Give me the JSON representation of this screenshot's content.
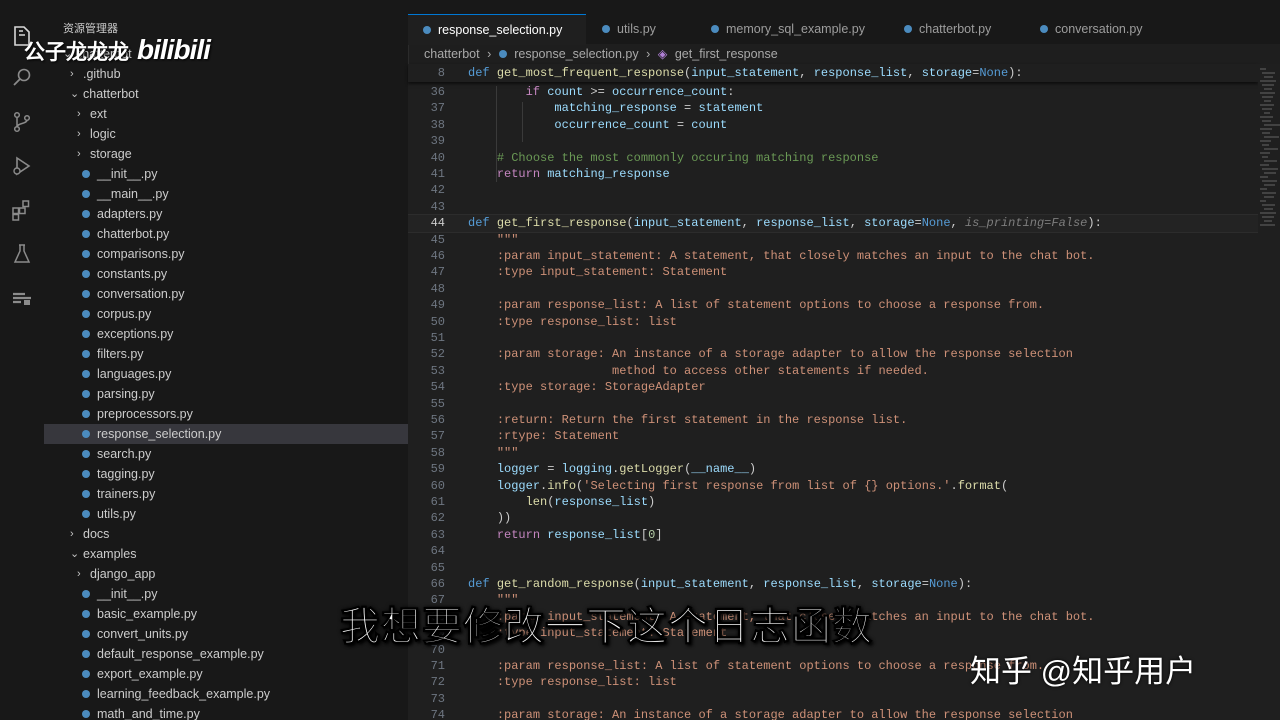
{
  "explorer": {
    "title": "资源管理器",
    "items": [
      {
        "label": "chatterbot",
        "kind": "folder",
        "open": true,
        "indent": 0
      },
      {
        "label": ".github",
        "kind": "folder",
        "open": false,
        "indent": 1
      },
      {
        "label": "chatterbot",
        "kind": "folder",
        "open": true,
        "indent": 1
      },
      {
        "label": "ext",
        "kind": "folder",
        "open": false,
        "indent": 2
      },
      {
        "label": "logic",
        "kind": "folder",
        "open": false,
        "indent": 2
      },
      {
        "label": "storage",
        "kind": "folder",
        "open": false,
        "indent": 2
      },
      {
        "label": "__init__.py",
        "kind": "py",
        "indent": 2
      },
      {
        "label": "__main__.py",
        "kind": "py",
        "indent": 2
      },
      {
        "label": "adapters.py",
        "kind": "py",
        "indent": 2
      },
      {
        "label": "chatterbot.py",
        "kind": "py",
        "indent": 2
      },
      {
        "label": "comparisons.py",
        "kind": "py",
        "indent": 2
      },
      {
        "label": "constants.py",
        "kind": "py",
        "indent": 2
      },
      {
        "label": "conversation.py",
        "kind": "py",
        "indent": 2
      },
      {
        "label": "corpus.py",
        "kind": "py",
        "indent": 2
      },
      {
        "label": "exceptions.py",
        "kind": "py",
        "indent": 2
      },
      {
        "label": "filters.py",
        "kind": "py",
        "indent": 2
      },
      {
        "label": "languages.py",
        "kind": "py",
        "indent": 2
      },
      {
        "label": "parsing.py",
        "kind": "py",
        "indent": 2
      },
      {
        "label": "preprocessors.py",
        "kind": "py",
        "indent": 2
      },
      {
        "label": "response_selection.py",
        "kind": "py",
        "indent": 2,
        "selected": true
      },
      {
        "label": "search.py",
        "kind": "py",
        "indent": 2
      },
      {
        "label": "tagging.py",
        "kind": "py",
        "indent": 2
      },
      {
        "label": "trainers.py",
        "kind": "py",
        "indent": 2
      },
      {
        "label": "utils.py",
        "kind": "py",
        "indent": 2
      },
      {
        "label": "docs",
        "kind": "folder",
        "open": false,
        "indent": 1
      },
      {
        "label": "examples",
        "kind": "folder",
        "open": true,
        "indent": 1
      },
      {
        "label": "django_app",
        "kind": "folder",
        "open": false,
        "indent": 2
      },
      {
        "label": "__init__.py",
        "kind": "py",
        "indent": 2
      },
      {
        "label": "basic_example.py",
        "kind": "py",
        "indent": 2
      },
      {
        "label": "convert_units.py",
        "kind": "py",
        "indent": 2
      },
      {
        "label": "default_response_example.py",
        "kind": "py",
        "indent": 2
      },
      {
        "label": "export_example.py",
        "kind": "py",
        "indent": 2
      },
      {
        "label": "learning_feedback_example.py",
        "kind": "py",
        "indent": 2
      },
      {
        "label": "math_and_time.py",
        "kind": "py",
        "indent": 2
      }
    ]
  },
  "tabs": [
    {
      "label": "response_selection.py",
      "active": true
    },
    {
      "label": "utils.py",
      "active": false
    },
    {
      "label": "memory_sql_example.py",
      "active": false
    },
    {
      "label": "chatterbot.py",
      "active": false
    },
    {
      "label": "conversation.py",
      "active": false
    }
  ],
  "breadcrumb": [
    "chatterbot",
    "›",
    "response_selection.py",
    "›",
    "get_first_response"
  ],
  "sticky": {
    "ln": "8",
    "tokens": [
      [
        "k",
        "def "
      ],
      [
        "fn",
        "get_most_frequent_response"
      ],
      [
        "",
        "("
      ],
      [
        "v",
        "input_statement"
      ],
      [
        "",
        ", "
      ],
      [
        "v",
        "response_list"
      ],
      [
        "",
        ", "
      ],
      [
        "v",
        "storage"
      ],
      [
        "",
        "="
      ],
      [
        "k",
        "None"
      ],
      [
        "",
        "):"
      ]
    ]
  },
  "code_lines": [
    {
      "ln": "36",
      "tokens": [
        [
          "",
          "        "
        ],
        [
          "kc",
          "if "
        ],
        [
          "v",
          "count"
        ],
        [
          "",
          " >= "
        ],
        [
          "v",
          "occurrence_count"
        ],
        [
          "",
          ":"
        ]
      ]
    },
    {
      "ln": "37",
      "tokens": [
        [
          "",
          "            "
        ],
        [
          "v",
          "matching_response"
        ],
        [
          "",
          " = "
        ],
        [
          "v",
          "statement"
        ]
      ]
    },
    {
      "ln": "38",
      "tokens": [
        [
          "",
          "            "
        ],
        [
          "v",
          "occurrence_count"
        ],
        [
          "",
          " = "
        ],
        [
          "v",
          "count"
        ]
      ]
    },
    {
      "ln": "39",
      "tokens": []
    },
    {
      "ln": "40",
      "tokens": [
        [
          "",
          "    "
        ],
        [
          "c",
          "# Choose the most commonly occuring matching response"
        ]
      ]
    },
    {
      "ln": "41",
      "tokens": [
        [
          "",
          "    "
        ],
        [
          "kc",
          "return "
        ],
        [
          "v",
          "matching_response"
        ]
      ]
    },
    {
      "ln": "42",
      "tokens": []
    },
    {
      "ln": "43",
      "tokens": []
    },
    {
      "ln": "44",
      "current": true,
      "tokens": [
        [
          "k",
          "def "
        ],
        [
          "fn",
          "get_first_response"
        ],
        [
          "",
          "("
        ],
        [
          "v",
          "input_statement"
        ],
        [
          "",
          ", "
        ],
        [
          "v",
          "response_list"
        ],
        [
          "",
          ", "
        ],
        [
          "v",
          "storage"
        ],
        [
          "",
          "="
        ],
        [
          "k",
          "None"
        ],
        [
          "",
          ", "
        ],
        [
          "hint",
          "is_printing=False"
        ],
        [
          "",
          "):"
        ]
      ]
    },
    {
      "ln": "45",
      "tokens": [
        [
          "",
          "    "
        ],
        [
          "s",
          "\"\"\""
        ]
      ]
    },
    {
      "ln": "46",
      "tokens": [
        [
          "",
          "    "
        ],
        [
          "s",
          ":param input_statement: A statement, that closely matches an input to the chat bot."
        ]
      ]
    },
    {
      "ln": "47",
      "tokens": [
        [
          "",
          "    "
        ],
        [
          "s",
          ":type input_statement: Statement"
        ]
      ]
    },
    {
      "ln": "48",
      "tokens": []
    },
    {
      "ln": "49",
      "tokens": [
        [
          "",
          "    "
        ],
        [
          "s",
          ":param response_list: A list of statement options to choose a response from."
        ]
      ]
    },
    {
      "ln": "50",
      "tokens": [
        [
          "",
          "    "
        ],
        [
          "s",
          ":type response_list: list"
        ]
      ]
    },
    {
      "ln": "51",
      "tokens": []
    },
    {
      "ln": "52",
      "tokens": [
        [
          "",
          "    "
        ],
        [
          "s",
          ":param storage: An instance of a storage adapter to allow the response selection"
        ]
      ]
    },
    {
      "ln": "53",
      "tokens": [
        [
          "",
          "                    "
        ],
        [
          "s",
          "method to access other statements if needed."
        ]
      ]
    },
    {
      "ln": "54",
      "tokens": [
        [
          "",
          "    "
        ],
        [
          "s",
          ":type storage: StorageAdapter"
        ]
      ]
    },
    {
      "ln": "55",
      "tokens": []
    },
    {
      "ln": "56",
      "tokens": [
        [
          "",
          "    "
        ],
        [
          "s",
          ":return: Return the first statement in the response list."
        ]
      ]
    },
    {
      "ln": "57",
      "tokens": [
        [
          "",
          "    "
        ],
        [
          "s",
          ":rtype: Statement"
        ]
      ]
    },
    {
      "ln": "58",
      "tokens": [
        [
          "",
          "    "
        ],
        [
          "s",
          "\"\"\""
        ]
      ]
    },
    {
      "ln": "59",
      "tokens": [
        [
          "",
          "    "
        ],
        [
          "v",
          "logger"
        ],
        [
          "",
          " = "
        ],
        [
          "v",
          "logging"
        ],
        [
          "",
          "."
        ],
        [
          "fn",
          "getLogger"
        ],
        [
          "",
          "("
        ],
        [
          "v",
          "__name__"
        ],
        [
          "",
          ")"
        ]
      ]
    },
    {
      "ln": "60",
      "tokens": [
        [
          "",
          "    "
        ],
        [
          "v",
          "logger"
        ],
        [
          "",
          "."
        ],
        [
          "fn",
          "info"
        ],
        [
          "",
          "("
        ],
        [
          "s",
          "'Selecting first response from list of {} options.'"
        ],
        [
          "",
          "."
        ],
        [
          "fn",
          "format"
        ],
        [
          "",
          "("
        ]
      ]
    },
    {
      "ln": "61",
      "tokens": [
        [
          "",
          "        "
        ],
        [
          "fn",
          "len"
        ],
        [
          "",
          "("
        ],
        [
          "v",
          "response_list"
        ],
        [
          "",
          ")"
        ]
      ]
    },
    {
      "ln": "62",
      "tokens": [
        [
          "",
          "    "
        ],
        [
          "",
          "))"
        ]
      ]
    },
    {
      "ln": "63",
      "tokens": [
        [
          "",
          "    "
        ],
        [
          "kc",
          "return "
        ],
        [
          "v",
          "response_list"
        ],
        [
          "",
          "["
        ],
        [
          "n",
          "0"
        ],
        [
          "",
          "]"
        ]
      ]
    },
    {
      "ln": "64",
      "tokens": []
    },
    {
      "ln": "65",
      "tokens": []
    },
    {
      "ln": "66",
      "tokens": [
        [
          "k",
          "def "
        ],
        [
          "fn",
          "get_random_response"
        ],
        [
          "",
          "("
        ],
        [
          "v",
          "input_statement"
        ],
        [
          "",
          ", "
        ],
        [
          "v",
          "response_list"
        ],
        [
          "",
          ", "
        ],
        [
          "v",
          "storage"
        ],
        [
          "",
          "="
        ],
        [
          "k",
          "None"
        ],
        [
          "",
          "):"
        ]
      ]
    },
    {
      "ln": "67",
      "tokens": [
        [
          "",
          "    "
        ],
        [
          "s",
          "\"\"\""
        ]
      ]
    },
    {
      "ln": "68",
      "tokens": [
        [
          "",
          "    "
        ],
        [
          "s",
          ":param input_statement: A statement, that closely matches an input to the chat bot."
        ]
      ]
    },
    {
      "ln": "69",
      "tokens": [
        [
          "",
          "    "
        ],
        [
          "s",
          ":type input_statement: Statement"
        ]
      ]
    },
    {
      "ln": "70",
      "tokens": []
    },
    {
      "ln": "71",
      "tokens": [
        [
          "",
          "    "
        ],
        [
          "s",
          ":param response_list: A list of statement options to choose a response from."
        ]
      ]
    },
    {
      "ln": "72",
      "tokens": [
        [
          "",
          "    "
        ],
        [
          "s",
          ":type response_list: list"
        ]
      ]
    },
    {
      "ln": "73",
      "tokens": []
    },
    {
      "ln": "74",
      "tokens": [
        [
          "",
          "    "
        ],
        [
          "s",
          ":param storage: An instance of a storage adapter to allow the response selection"
        ]
      ]
    }
  ],
  "overlay": {
    "subtitle": "我想要修改一下这个日志函数",
    "watermark_zhihu": "知乎 @知乎用户",
    "watermark_user": "公子龙龙龙",
    "watermark_brand": "bilibili"
  }
}
